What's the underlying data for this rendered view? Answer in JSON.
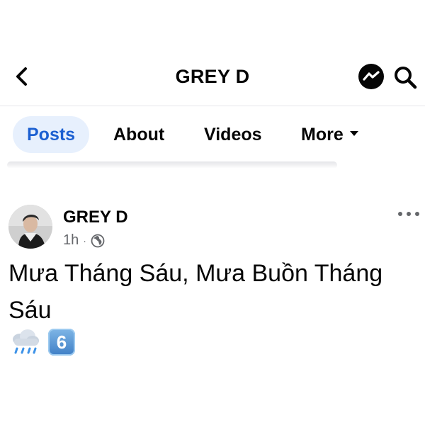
{
  "header": {
    "title": "GREY D",
    "back_icon": "chevron-left-icon",
    "messenger_icon": "messenger-icon",
    "search_icon": "search-icon"
  },
  "tabs": [
    {
      "label": "Posts",
      "active": true
    },
    {
      "label": "About",
      "active": false
    },
    {
      "label": "Videos",
      "active": false
    },
    {
      "label": "More",
      "active": false
    }
  ],
  "post": {
    "author": "GREY D",
    "time": "1h",
    "separator": "·",
    "privacy_icon": "globe-icon",
    "text": "Mưa Tháng Sáu, Mưa Buồn Tháng Sáu",
    "emojis": [
      "rain-cloud-icon",
      "keycap-six-icon"
    ],
    "keycap_value": "6"
  },
  "colors": {
    "accent": "#1b5fd1",
    "active_tab_bg": "#e7f0fd",
    "text": "#050505",
    "secondary_text": "#65676b"
  }
}
